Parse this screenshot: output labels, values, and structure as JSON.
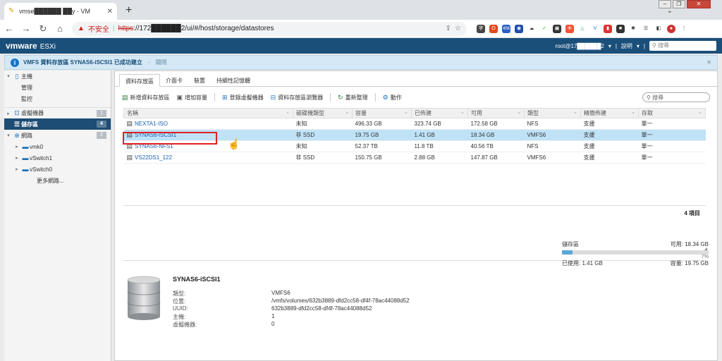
{
  "browser": {
    "tab_title": "vmse██████ ██y - VM",
    "address_insecure": "不安全",
    "address_scheme": "https",
    "address_rest": "://172██████2/ui/#/host/storage/datastores",
    "ext_badge": "456"
  },
  "esxi": {
    "brand": "vmware",
    "product": "ESXi",
    "user": "root@17██████2",
    "help": "說明",
    "search_placeholder": "搜尋"
  },
  "notice": {
    "message": "VMFS 資料存放區 SYNAS6-iSCSI1 已成功建立",
    "separator": "-",
    "link": "關閉"
  },
  "sidebar": {
    "items": [
      {
        "label": "主機",
        "icon": "host-icon",
        "badge": ""
      },
      {
        "label": "管理",
        "icon": "",
        "badge": ""
      },
      {
        "label": "監控",
        "icon": "",
        "badge": ""
      },
      {
        "label": "虛擬機器",
        "icon": "vm-icon",
        "badge": "1"
      },
      {
        "label": "儲存區",
        "icon": "storage-icon",
        "badge": "4"
      },
      {
        "label": "網路",
        "icon": "network-icon",
        "badge": "2"
      },
      {
        "label": "vmk0",
        "icon": "nic-icon",
        "badge": ""
      },
      {
        "label": "vSwitch1",
        "icon": "switch-icon",
        "badge": ""
      },
      {
        "label": "vSwitch0",
        "icon": "switch-icon",
        "badge": ""
      },
      {
        "label": "更多網路...",
        "icon": "",
        "badge": ""
      }
    ]
  },
  "content": {
    "tabs": [
      "資料存放區",
      "介面卡",
      "裝置",
      "持續性記憶體"
    ],
    "actions": [
      "新增資料存放區",
      "增加容量",
      "登錄虛擬機器",
      "資料存放區瀏覽器",
      "重新整理",
      "動作"
    ],
    "grid_search_placeholder": "搜尋",
    "columns": [
      "名稱",
      "磁碟機類型",
      "容量",
      "已佈建",
      "可用",
      "類型",
      "精簡佈建",
      "存取"
    ],
    "rows": [
      [
        "NEXTA1-ISO",
        "未知",
        "496.33 GB",
        "323.74 GB",
        "172.58 GB",
        "NFS",
        "支援",
        "單一"
      ],
      [
        "SYNAS6-iSCSI1",
        "非 SSD",
        "19.75 GB",
        "1.41 GB",
        "18.34 GB",
        "VMFS6",
        "支援",
        "單一"
      ],
      [
        "SYNAS6-NFS1",
        "未知",
        "52.37 TB",
        "11.8 TB",
        "40.56 TB",
        "NFS",
        "支援",
        "單一"
      ],
      [
        "VS22DS1_122",
        "非 SSD",
        "150.75 GB",
        "2.88 GB",
        "147.87 GB",
        "VMFS6",
        "支援",
        "單一"
      ]
    ],
    "item_count": "4 項目"
  },
  "details": {
    "title": "SYNAS6-iSCSI1",
    "fields": [
      {
        "k": "類型:",
        "v": "VMFS6"
      },
      {
        "k": "位置:",
        "v": "/vmfs/volumes/632b3889-dfd2cc58-df4f-78ac44088d52"
      },
      {
        "k": "UUID:",
        "v": "632b3889-dfd2cc58-df4f-78ac44088d52"
      },
      {
        "k": "主機:",
        "v": "1"
      },
      {
        "k": "虛擬機器:",
        "v": "0"
      }
    ]
  },
  "capacity": {
    "label": "儲存區",
    "free": "可用: 18.34 GB",
    "used_pct": 7,
    "used_pct_label": "7%",
    "used": "已使用: 1.41 GB",
    "total": "容量: 19.75 GB"
  },
  "colors": {
    "header": "#1a4f7a",
    "selected_row": "#bfe2f7",
    "sidebar_active": "#1d4c74"
  }
}
